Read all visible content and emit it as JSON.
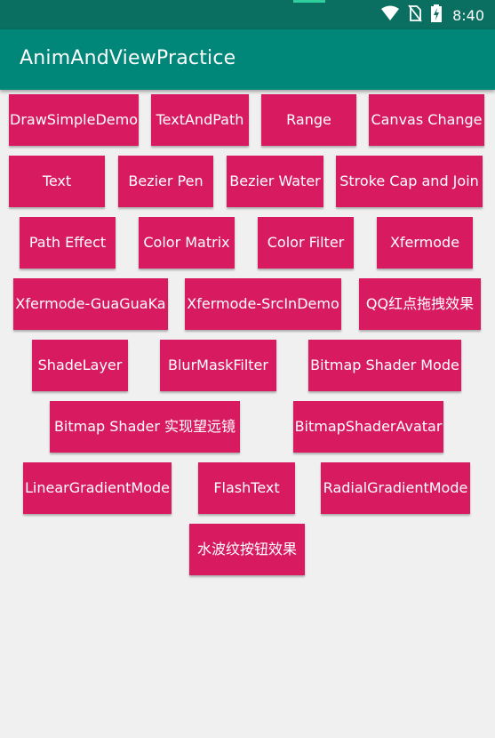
{
  "status_bar": {
    "time": "8:40",
    "icons": [
      "wifi-icon",
      "no-sim-icon",
      "battery-charging-icon"
    ]
  },
  "app_bar": {
    "title": "AnimAndViewPractice"
  },
  "colors": {
    "status_bar": "#0a6e60",
    "app_bar": "#00877a",
    "button": "#d81b60",
    "background": "#f0f0f0"
  },
  "buttons": [
    "DrawSimpleDemo",
    "TextAndPath",
    "Range",
    "Canvas Change",
    "Text",
    "Bezier Pen",
    "Bezier Water",
    "Stroke Cap and Join",
    "Path Effect",
    "Color Matrix",
    "Color Filter",
    "Xfermode",
    "Xfermode-GuaGuaKa",
    "Xfermode-SrcInDemo",
    "QQ红点拖拽效果",
    "ShadeLayer",
    "BlurMaskFilter",
    "Bitmap Shader Mode",
    "Bitmap Shader 实现望远镜",
    "BitmapShaderAvatar",
    "LinearGradientMode",
    "FlashText",
    "RadialGradientMode",
    "水波纹按钮效果"
  ]
}
